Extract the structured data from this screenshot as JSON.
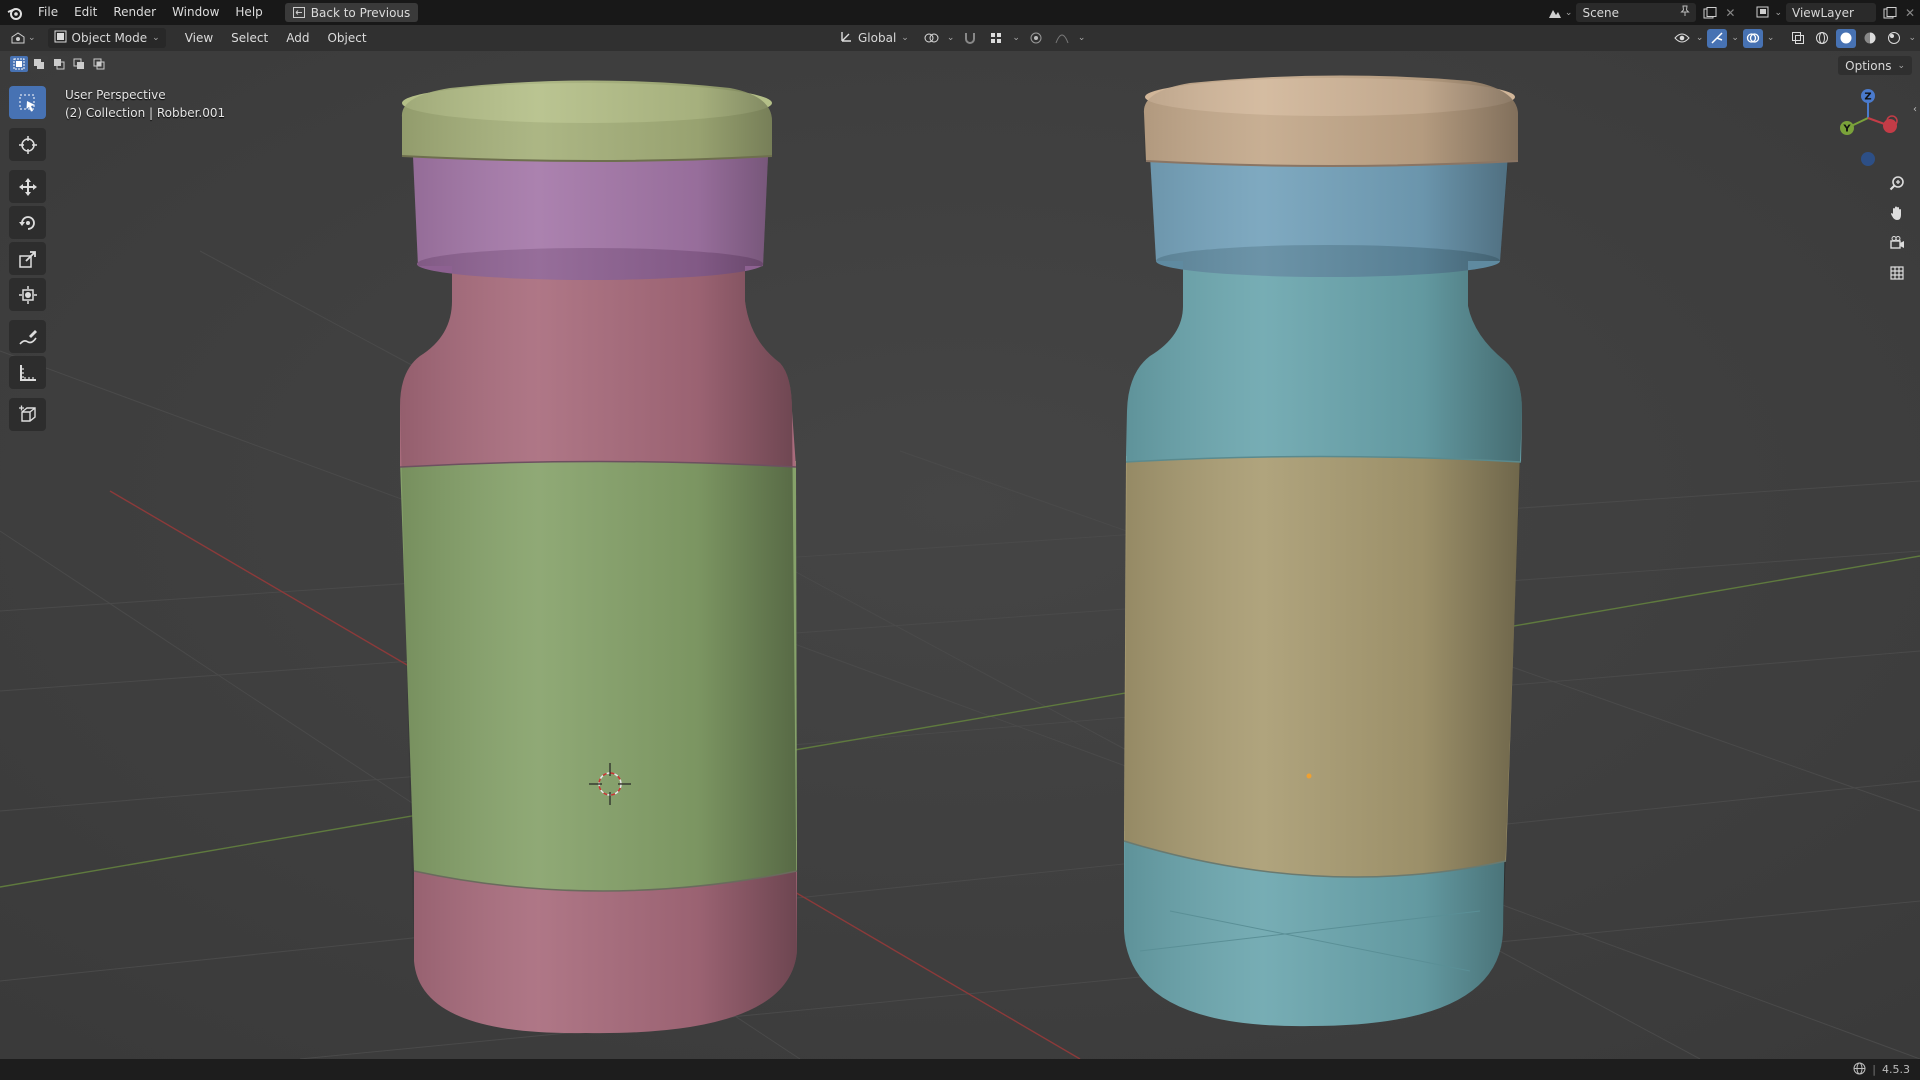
{
  "app": {
    "menu": [
      "File",
      "Edit",
      "Render",
      "Window",
      "Help"
    ],
    "back_button": "Back to Previous",
    "scene_name": "Scene",
    "view_layer": "ViewLayer"
  },
  "header": {
    "mode": "Object Mode",
    "menus": [
      "View",
      "Select",
      "Add",
      "Object"
    ],
    "transform_orientation": "Global"
  },
  "viewport": {
    "perspective_label": "User Perspective",
    "collection_label": "(2) Collection | Robber.001",
    "options_label": "Options",
    "gizmo": {
      "z": "Z",
      "y": "Y"
    }
  },
  "tools": [
    {
      "name": "select-box-tool",
      "icon": "select-box-icon",
      "active": true
    },
    {
      "name": "cursor-tool",
      "icon": "cursor-icon",
      "active": false
    },
    {
      "name": "move-tool",
      "icon": "move-icon",
      "active": false
    },
    {
      "name": "rotate-tool",
      "icon": "rotate-icon",
      "active": false
    },
    {
      "name": "scale-tool",
      "icon": "scale-icon",
      "active": false
    },
    {
      "name": "transform-tool",
      "icon": "transform-icon",
      "active": false
    },
    {
      "name": "annotate-tool",
      "icon": "annotate-icon",
      "active": false
    },
    {
      "name": "measure-tool",
      "icon": "measure-icon",
      "active": false
    },
    {
      "name": "add-cube-tool",
      "icon": "add-cube-icon",
      "active": false
    }
  ],
  "status": {
    "version": "4.5.3"
  },
  "colors": {
    "accent": "#4772b3",
    "left_cap": "#a5b07a",
    "left_neck": "#a477a8",
    "left_body": "#a86b7c",
    "left_label": "#86a26a",
    "right_cap": "#c3a88a",
    "right_body": "#6ba6ae",
    "right_label": "#a99c72"
  }
}
